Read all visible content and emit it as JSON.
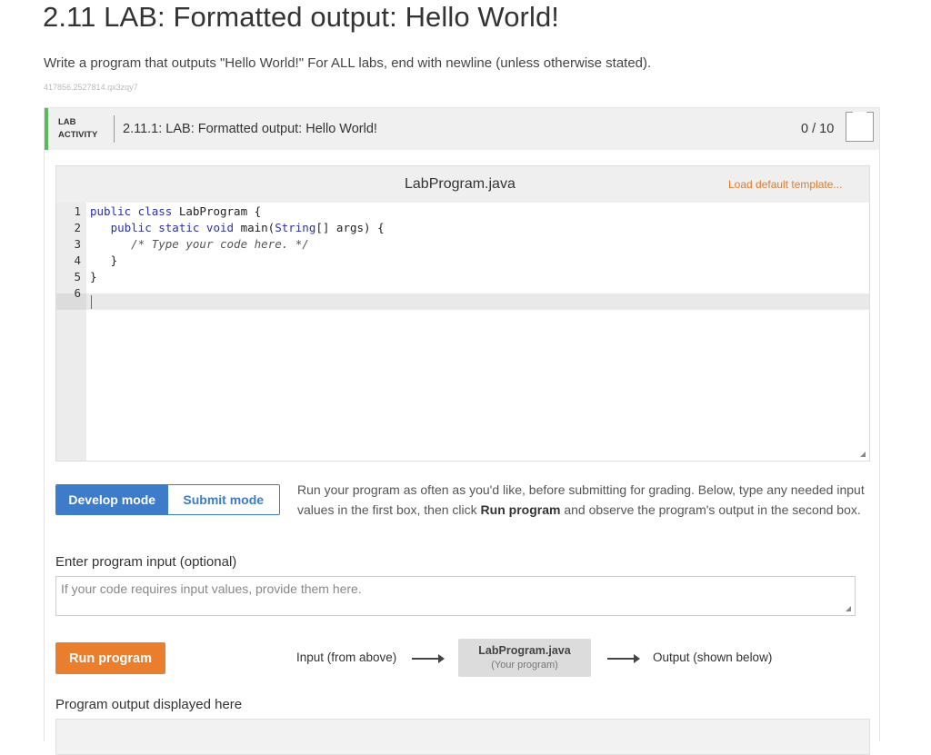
{
  "page": {
    "title": "2.11 LAB: Formatted output: Hello World!",
    "prompt": "Write a program that outputs \"Hello World!\" For ALL labs, end with newline (unless otherwise stated).",
    "code_id": "417856.2527814.qx3zqy7"
  },
  "activity": {
    "tag_line1": "LAB",
    "tag_line2": "ACTIVITY",
    "title": "2.11.1: LAB: Formatted output: Hello World!",
    "score": "0 / 10"
  },
  "editor": {
    "filename": "LabProgram.java",
    "load_template": "Load default template...",
    "line_numbers": [
      "1",
      "2",
      "3",
      "4",
      "5",
      "6"
    ]
  },
  "modes": {
    "develop": "Develop mode",
    "submit": "Submit mode",
    "description_pre": "Run your program as often as you'd like, before submitting for grading. Below, type any needed input values in the first box, then click ",
    "description_bold": "Run program",
    "description_post": " and observe the program's output in the second box."
  },
  "input": {
    "label": "Enter program input (optional)",
    "placeholder": "If your code requires input values, provide them here."
  },
  "run": {
    "button": "Run program",
    "flow_input": "Input (from above)",
    "program_name": "LabProgram.java",
    "program_sub": "(Your program)",
    "flow_output": "Output (shown below)"
  },
  "output": {
    "label": "Program output displayed here"
  },
  "colors": {
    "accent_green": "#5cb85c",
    "primary_blue": "#3d7cc9",
    "orange": "#e87e2e",
    "link_orange": "#e07b2e"
  }
}
